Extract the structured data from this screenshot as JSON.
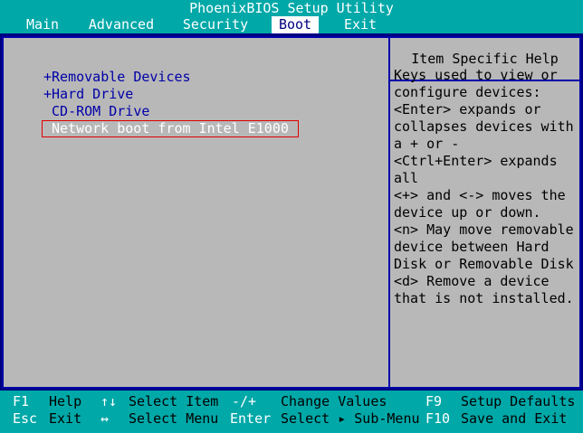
{
  "window": {
    "title": "PhoenixBIOS Setup Utility"
  },
  "menu": {
    "tabs": [
      {
        "label": "Main"
      },
      {
        "label": "Advanced"
      },
      {
        "label": "Security"
      },
      {
        "label": "Boot"
      },
      {
        "label": "Exit"
      }
    ],
    "active": "Boot"
  },
  "boot_list": [
    {
      "label": "+Removable Devices"
    },
    {
      "label": "+Hard Drive"
    },
    {
      "label": " CD-ROM Drive"
    },
    {
      "label": "Network boot from Intel E1000"
    }
  ],
  "help": {
    "title": "Item Specific Help",
    "lines": [
      "Keys used to view or",
      "configure devices:",
      "<Enter> expands or",
      "collapses devices with",
      "a + or -",
      "<Ctrl+Enter> expands",
      "all",
      "<+> and <-> moves the",
      "device up or down.",
      "<n> May move removable",
      "device between Hard",
      "Disk or Removable Disk",
      "<d> Remove a device",
      "that is not installed."
    ]
  },
  "footer": {
    "row1": [
      {
        "key": "F1",
        "desc": "Help"
      },
      {
        "key": "↑↓",
        "desc": "Select Item"
      },
      {
        "key": "-/+",
        "desc": "Change Values"
      },
      {
        "key": "F9",
        "desc": "Setup Defaults"
      }
    ],
    "row2": [
      {
        "key": "Esc",
        "desc": "Exit"
      },
      {
        "key": "↔",
        "desc": "Select Menu"
      },
      {
        "key": "Enter",
        "desc": "Select ▸ Sub-Menu"
      },
      {
        "key": "F10",
        "desc": "Save and Exit"
      }
    ]
  },
  "colors": {
    "background": "#000080",
    "menu_bar": "#00a8a8",
    "panel": "#b8b8b8",
    "item_text": "#0000a8",
    "selection_outline": "#e00000"
  }
}
